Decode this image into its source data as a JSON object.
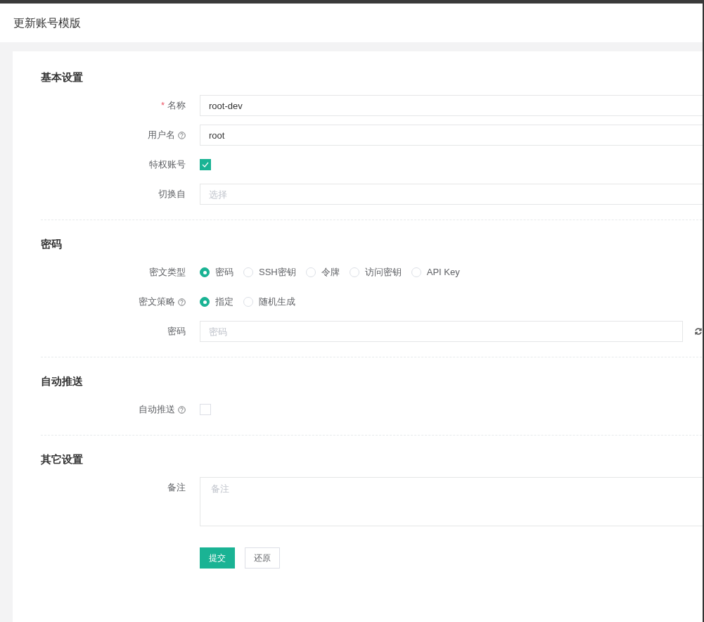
{
  "dialog": {
    "title": "更新账号模版"
  },
  "sections": [
    {
      "title": "基本设置",
      "fields": [
        {
          "kind": "text",
          "label": "名称",
          "required_mark": "*",
          "help": false,
          "value": "root-dev"
        },
        {
          "kind": "text",
          "label": "用户名",
          "help": true,
          "value": "root"
        },
        {
          "kind": "checkbox",
          "label": "特权账号",
          "help": false,
          "checked": true
        },
        {
          "kind": "select",
          "label": "切换自",
          "help": false,
          "placeholder": "选择"
        }
      ]
    },
    {
      "title": "密码",
      "fields": [
        {
          "kind": "radio",
          "label": "密文类型",
          "help": false,
          "options": [
            {
              "label": "密码",
              "selected": true
            },
            {
              "label": "SSH密钥",
              "selected": false
            },
            {
              "label": "令牌",
              "selected": false
            },
            {
              "label": "访问密钥",
              "selected": false
            },
            {
              "label": "API Key",
              "selected": false
            }
          ]
        },
        {
          "kind": "radio",
          "label": "密文策略",
          "help": true,
          "options": [
            {
              "label": "指定",
              "selected": true
            },
            {
              "label": "随机生成",
              "selected": false
            }
          ]
        },
        {
          "kind": "password",
          "label": "密码",
          "help": false,
          "placeholder": "密码"
        }
      ]
    },
    {
      "title": "自动推送",
      "fields": [
        {
          "kind": "checkbox",
          "label": "自动推送",
          "help": true,
          "checked": false
        }
      ]
    },
    {
      "title": "其它设置",
      "fields": [
        {
          "kind": "textarea",
          "label": "备注",
          "help": false,
          "placeholder": "备注"
        }
      ]
    }
  ],
  "buttons": [
    {
      "label": "提交",
      "primary": true
    },
    {
      "label": "还原",
      "primary": false
    }
  ]
}
